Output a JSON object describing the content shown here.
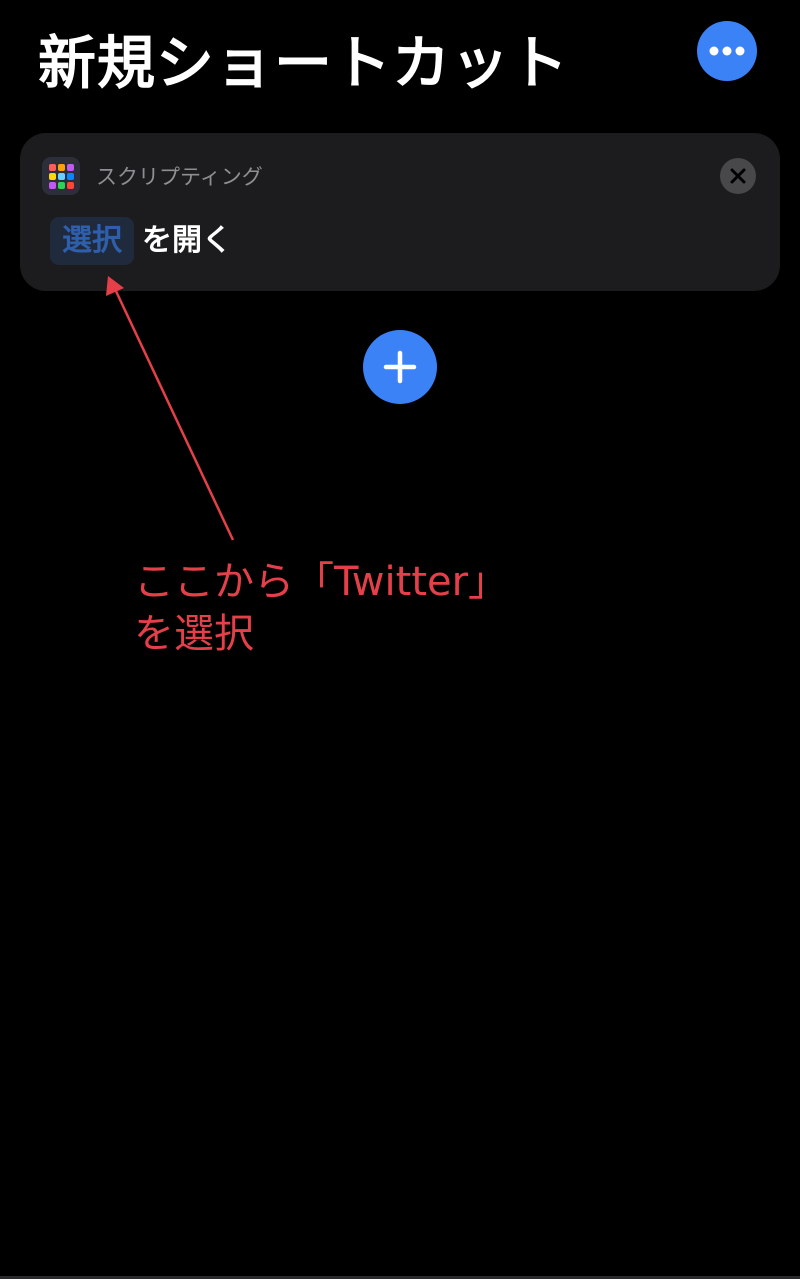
{
  "header": {
    "title": "新規ショートカット",
    "more_icon": "ellipsis-icon",
    "accent": "#3b82f6"
  },
  "action_card": {
    "category_label": "スクリプティング",
    "category_icon": "scripting-grid-icon",
    "remove_icon": "close-icon",
    "param_token": "選択",
    "action_text": "を開く"
  },
  "add_action": {
    "icon": "plus-icon"
  },
  "annotation": {
    "line1": "ここから「Twitter」",
    "line2": "を選択",
    "color": "#e5404a"
  }
}
